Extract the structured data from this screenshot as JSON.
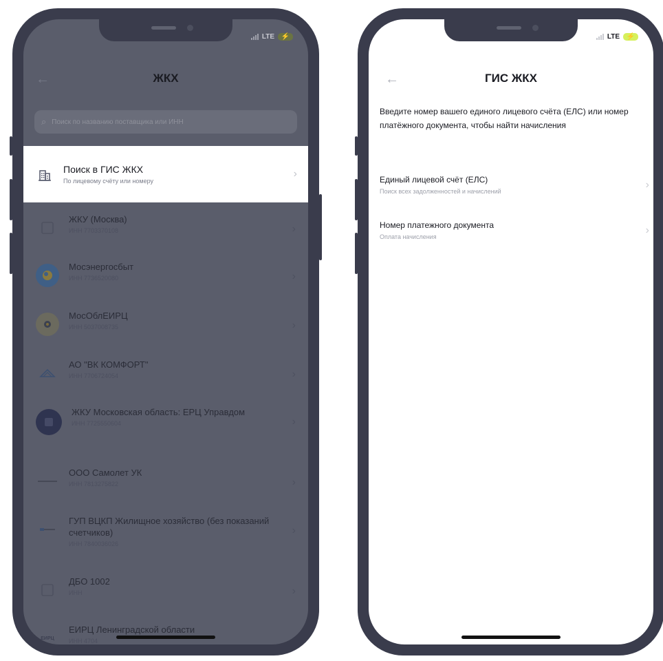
{
  "status": {
    "network": "LTE",
    "battery_symbol": "⚡"
  },
  "left_screen": {
    "title": "ЖКХ",
    "search_placeholder": "Поиск по названию поставщика или ИНН",
    "gis_item": {
      "title": "Поиск в ГИС ЖКХ",
      "subtitle": "По лицевому счёту или номеру"
    },
    "providers": [
      {
        "name": "ЖКУ (Москва)",
        "inn": "ИНН 7703370108",
        "icon": "square-outline-icon"
      },
      {
        "name": "Мосэнергосбыт",
        "inn": "ИНН 7736520080",
        "icon": "mosenergosbyt-logo-icon"
      },
      {
        "name": "МосОблЕИРЦ",
        "inn": "ИНН 5037008735",
        "icon": "mosobleirc-logo-icon"
      },
      {
        "name": "АО \"ВК КОМФОРТ\"",
        "inn": "ИНН 7706724054",
        "icon": "vk-comfort-logo-icon"
      },
      {
        "name": "ЖКУ Московская область: ЕРЦ Управдом",
        "inn": "ИНН 7725550604",
        "icon": "erc-upravdom-logo-icon"
      },
      {
        "name": "ООО Самолет УК",
        "inn": "ИНН 7813275822",
        "icon": "samolet-logo-icon"
      },
      {
        "name": "ГУП ВЦКП Жилищное хозяйство (без показаний счетчиков)",
        "inn": "ИНН 7840036026",
        "icon": "vckp-logo-icon"
      },
      {
        "name": "ДБО 1002",
        "inn": "ИНН",
        "icon": "square-outline-icon"
      },
      {
        "name": "ЕИРЦ Ленинградской области",
        "inn": "ИНН 4704",
        "icon": "eirc-logo-icon",
        "icon_text": "ЕИРЦ"
      }
    ]
  },
  "right_screen": {
    "title": "ГИС ЖКХ",
    "intro": "Введите номер вашего единого лицевого счёта (ЕЛС) или номер платёжного документа, чтобы найти начисления",
    "options": [
      {
        "title": "Единый лицевой счёт (ЕЛС)",
        "subtitle": "Поиск всех задолженностей и начислений"
      },
      {
        "title": "Номер платежного документа",
        "subtitle": "Оплата начисления"
      }
    ]
  },
  "colors": {
    "accent_battery": "#d6f05c",
    "phone_frame": "#3a3c4c",
    "overlay": "#5a5d6b"
  }
}
